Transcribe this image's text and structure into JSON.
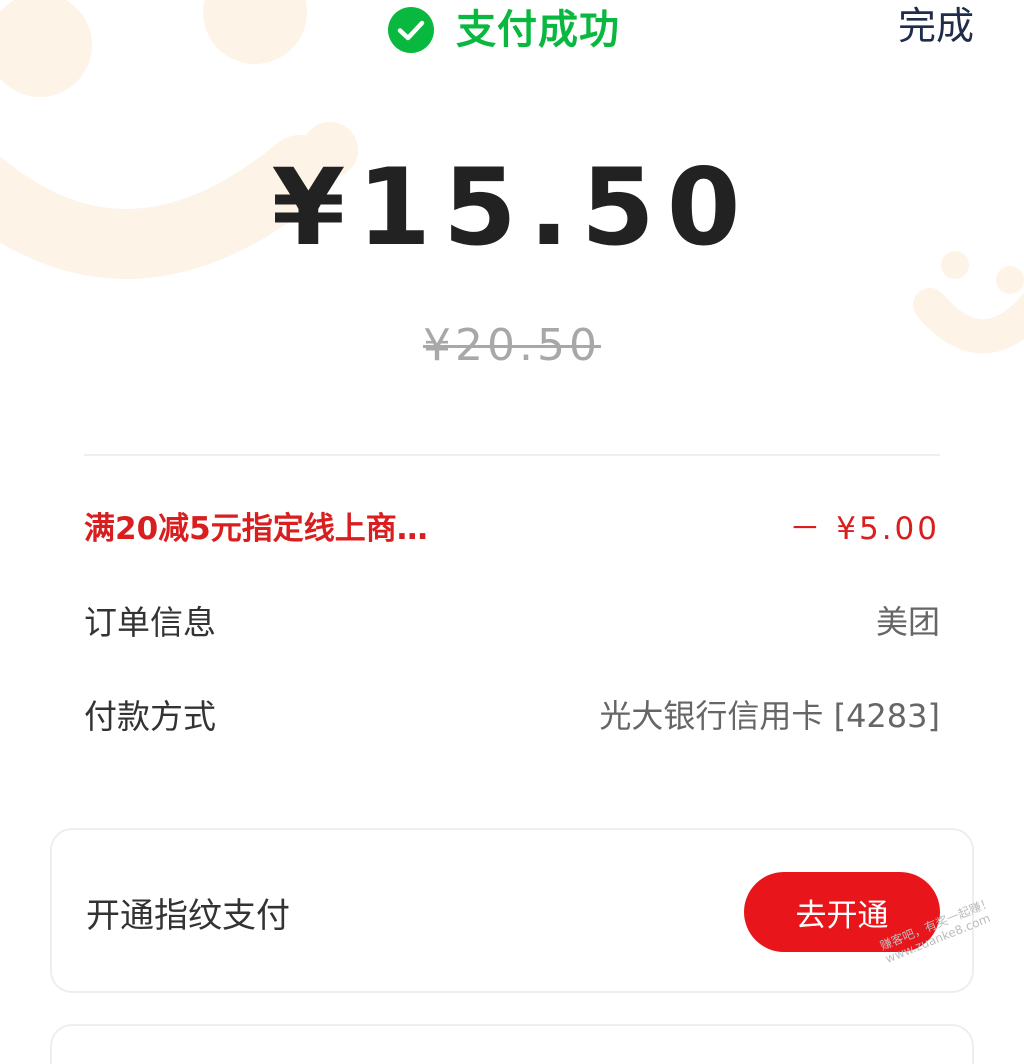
{
  "header": {
    "status_text": "支付成功",
    "done_label": "完成",
    "status_color": "#09b83e"
  },
  "payment": {
    "amount": "¥15.50",
    "original_amount": "¥20.50"
  },
  "details": {
    "discount": {
      "label": "满20减5元指定线上商…",
      "value": "－ ¥5.00"
    },
    "order": {
      "label": "订单信息",
      "value": "美团"
    },
    "method": {
      "label": "付款方式",
      "value": "光大银行信用卡 [4283]"
    }
  },
  "fingerprint_card": {
    "label": "开通指纹支付",
    "button_label": "去开通",
    "button_color": "#e8151b"
  },
  "watermark": {
    "line1": "赚客吧，有奖一起赚！",
    "line2": "www.zuanke8.com"
  },
  "icons": {
    "status_icon": "check-circle-icon"
  },
  "colors": {
    "discount": "#d81e1e",
    "decoration": "#fdf3e7"
  }
}
